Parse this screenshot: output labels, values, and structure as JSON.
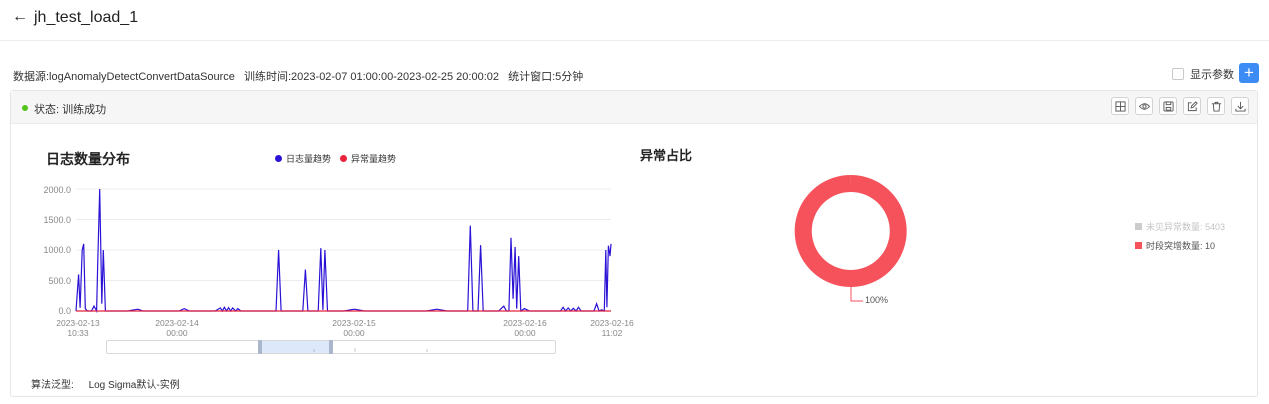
{
  "header": {
    "title": "jh_test_load_1",
    "back_icon": "arrow-left-icon"
  },
  "meta": {
    "datasource": "数据源:logAnomalyDetectConvertDataSource",
    "train_time": "训练时间:2023-02-07 01:00:00-2023-02-25 20:00:02",
    "window": "统计窗口:5分钟"
  },
  "params": {
    "label": "显示参数",
    "checked": false,
    "add_label": "+"
  },
  "status": {
    "text": "状态: 训练成功",
    "color": "#52c41a"
  },
  "toolbar": {
    "icons": [
      "table-icon",
      "eye-icon",
      "save-icon",
      "edit-icon",
      "trash-icon",
      "download-icon"
    ]
  },
  "algo": {
    "label": "算法泛型:",
    "value": "Log Sigma默认-实例"
  },
  "colors": {
    "accent": "#3d8bf5",
    "series1": "#2a12d6",
    "series2": "#e8233b",
    "pie": "#f5525c",
    "pie_muted": "#cccccc"
  },
  "chart_data": [
    {
      "type": "line",
      "title": "日志数量分布",
      "ylim": [
        0,
        2000
      ],
      "y_ticks": [
        "0.0",
        "500.0",
        "1000.0",
        "1500.0",
        "2000.0"
      ],
      "x_ticks": [
        {
          "line1": "2023-02-13",
          "line2": "10:33"
        },
        {
          "line1": "2023-02-14",
          "line2": "00:00"
        },
        {
          "line1": "2023-02-15",
          "line2": "00:00"
        },
        {
          "line1": "2023-02-16",
          "line2": "00:00"
        },
        {
          "line1": "2023-02-16",
          "line2": "11:02"
        }
      ],
      "grid": true,
      "legend_position": "top",
      "series": [
        {
          "name": "日志量趋势",
          "points": [
            [
              0.0,
              0
            ],
            [
              0.5,
              600
            ],
            [
              0.8,
              50
            ],
            [
              1.2,
              1000
            ],
            [
              1.5,
              1100
            ],
            [
              1.8,
              40
            ],
            [
              2.2,
              0
            ],
            [
              3.0,
              0
            ],
            [
              3.5,
              80
            ],
            [
              4.0,
              0
            ],
            [
              4.2,
              700
            ],
            [
              4.6,
              2000
            ],
            [
              5.0,
              120
            ],
            [
              5.3,
              1000
            ],
            [
              5.7,
              0
            ],
            [
              10.0,
              0
            ],
            [
              12.0,
              30
            ],
            [
              13.0,
              0
            ],
            [
              20.0,
              0
            ],
            [
              21.0,
              40
            ],
            [
              22.0,
              0
            ],
            [
              27.0,
              0
            ],
            [
              28.0,
              50
            ],
            [
              28.4,
              0
            ],
            [
              28.8,
              60
            ],
            [
              29.2,
              0
            ],
            [
              29.6,
              55
            ],
            [
              30.0,
              0
            ],
            [
              30.4,
              50
            ],
            [
              31.0,
              0
            ],
            [
              31.4,
              40
            ],
            [
              32.0,
              0
            ],
            [
              35.0,
              0
            ],
            [
              38.8,
              0
            ],
            [
              39.3,
              1000
            ],
            [
              39.8,
              0
            ],
            [
              44.0,
              0
            ],
            [
              44.5,
              680
            ],
            [
              45.0,
              0
            ],
            [
              47.0,
              0
            ],
            [
              47.5,
              1030
            ],
            [
              47.9,
              20
            ],
            [
              48.3,
              1000
            ],
            [
              48.8,
              0
            ],
            [
              52.0,
              0
            ],
            [
              54.0,
              30
            ],
            [
              56.0,
              0
            ],
            [
              62.0,
              0
            ],
            [
              68.0,
              0
            ],
            [
              70.0,
              30
            ],
            [
              72.0,
              0
            ],
            [
              76.0,
              0
            ],
            [
              76.5,
              1400
            ],
            [
              77.0,
              0
            ],
            [
              78.0,
              0
            ],
            [
              78.5,
              1080
            ],
            [
              79.0,
              0
            ],
            [
              82.0,
              0
            ],
            [
              83.0,
              80
            ],
            [
              83.5,
              0
            ],
            [
              84.0,
              0
            ],
            [
              84.4,
              1200
            ],
            [
              84.8,
              200
            ],
            [
              85.2,
              1050
            ],
            [
              85.5,
              40
            ],
            [
              85.9,
              900
            ],
            [
              86.3,
              0
            ],
            [
              87.0,
              40
            ],
            [
              88.0,
              0
            ],
            [
              91.0,
              0
            ],
            [
              94.0,
              0
            ],
            [
              94.5,
              60
            ],
            [
              95.0,
              0
            ],
            [
              95.5,
              50
            ],
            [
              96.0,
              0
            ],
            [
              96.5,
              45
            ],
            [
              97.0,
              0
            ],
            [
              97.5,
              60
            ],
            [
              98.0,
              0
            ],
            [
              99.0,
              0
            ],
            [
              100.5,
              0
            ],
            [
              101.0,
              120
            ],
            [
              101.5,
              0
            ],
            [
              102.0,
              20
            ],
            [
              102.5,
              0
            ],
            [
              102.8,
              1000
            ],
            [
              103.0,
              60
            ],
            [
              103.3,
              1070
            ],
            [
              103.6,
              900
            ],
            [
              103.8,
              1100
            ]
          ]
        },
        {
          "name": "异常量趋势",
          "points": [
            [
              0,
              0
            ],
            [
              103.8,
              0
            ]
          ]
        }
      ]
    },
    {
      "type": "pie",
      "title": "异常占比",
      "slices": [
        {
          "name": "未见异常数量",
          "value": 5403
        },
        {
          "name": "时段突增数量",
          "value": 10
        }
      ],
      "slice_label": "100%",
      "legend_labels": [
        "未见异常数量: 5403",
        "时段突增数量: 10"
      ]
    }
  ]
}
